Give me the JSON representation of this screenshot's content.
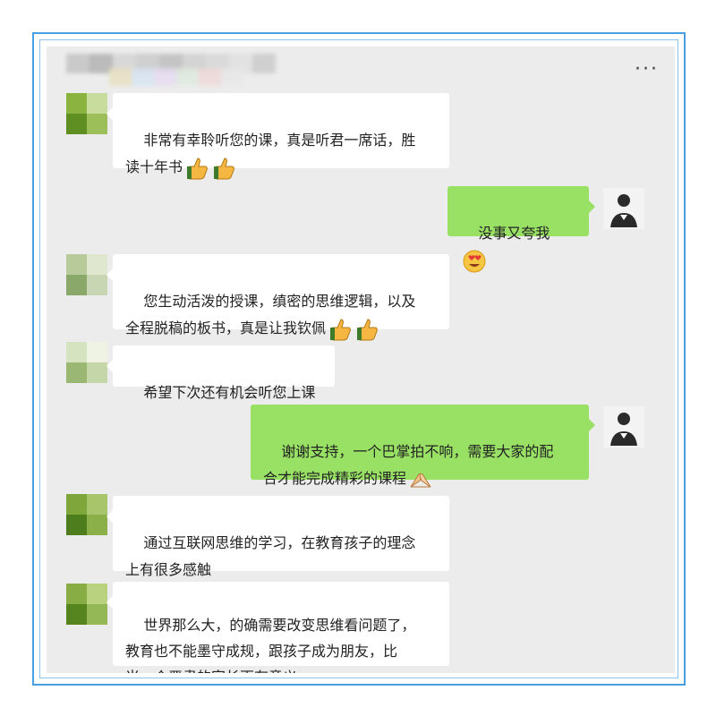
{
  "window": {
    "more_label": "···"
  },
  "colors": {
    "incoming": "#ffffff",
    "outgoing": "#98e165",
    "background": "#ececec",
    "frame": "#4a9fe0"
  },
  "messages": [
    {
      "side": "in",
      "text": "非常有幸聆听您的课，真是听君一席话，胜\n读十年书",
      "emojis": [
        "thumbs-up-icon",
        "thumbs-up-icon"
      ]
    },
    {
      "side": "out",
      "text": "没事又夸我",
      "emojis": [
        "heart-eyes-icon"
      ]
    },
    {
      "side": "in",
      "text": "您生动活泼的授课，缜密的思维逻辑，以及\n全程脱稿的板书，真是让我钦佩",
      "emojis": [
        "thumbs-up-icon",
        "thumbs-up-icon"
      ]
    },
    {
      "side": "in",
      "text": "希望下次还有机会听您上课",
      "emojis": []
    },
    {
      "side": "out",
      "text": "谢谢支持，一个巴掌拍不响，需要大家的配\n合才能完成精彩的课程",
      "emojis": [
        "handshake-icon"
      ]
    },
    {
      "side": "in",
      "text": "通过互联网思维的学习，在教育孩子的理念\n上有很多感触",
      "emojis": []
    },
    {
      "side": "in",
      "text": "世界那么大，的确需要改变思维看问题了，\n教育也不能墨守成规，跟孩子成为朋友，比\n当一个严肃的家长更有意义",
      "emojis": []
    }
  ]
}
